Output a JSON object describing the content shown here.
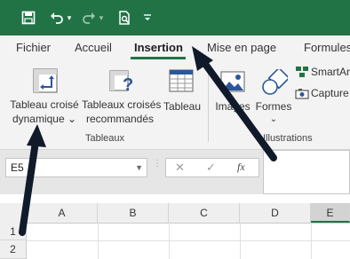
{
  "quick_access": {
    "save_icon": "save-icon",
    "undo_icon": "undo-icon",
    "redo_icon": "redo-icon",
    "print_preview_icon": "print-preview-icon",
    "customize_icon": "customize-qat-icon"
  },
  "tabs": [
    {
      "label": "Fichier"
    },
    {
      "label": "Accueil"
    },
    {
      "label": "Insertion",
      "active": true
    },
    {
      "label": "Mise en page"
    },
    {
      "label": "Formules"
    }
  ],
  "ribbon": {
    "pivot_table": {
      "line1": "Tableau croisé",
      "line2": "dynamique",
      "chevron": "⌄"
    },
    "recommended_pivot": {
      "line1": "Tableaux croisés",
      "line2": "recommandés"
    },
    "table": {
      "label": "Tableau"
    },
    "group_tables": "Tableaux",
    "images": {
      "label": "Images"
    },
    "shapes": {
      "label": "Formes",
      "chevron": "⌄"
    },
    "smartart": {
      "label": "SmartArt"
    },
    "capture": {
      "label": "Capture"
    },
    "group_illustrations": "Illustrations"
  },
  "formula_bar": {
    "name_box": "E5",
    "cancel_symbol": "✕",
    "enter_symbol": "✓",
    "fx_symbol": "fx"
  },
  "grid": {
    "columns": [
      "A",
      "B",
      "C",
      "D",
      "E"
    ],
    "rows": [
      "1",
      "2"
    ]
  },
  "colors": {
    "brand": "#217346",
    "annotation_arrow": "#111a2a"
  }
}
